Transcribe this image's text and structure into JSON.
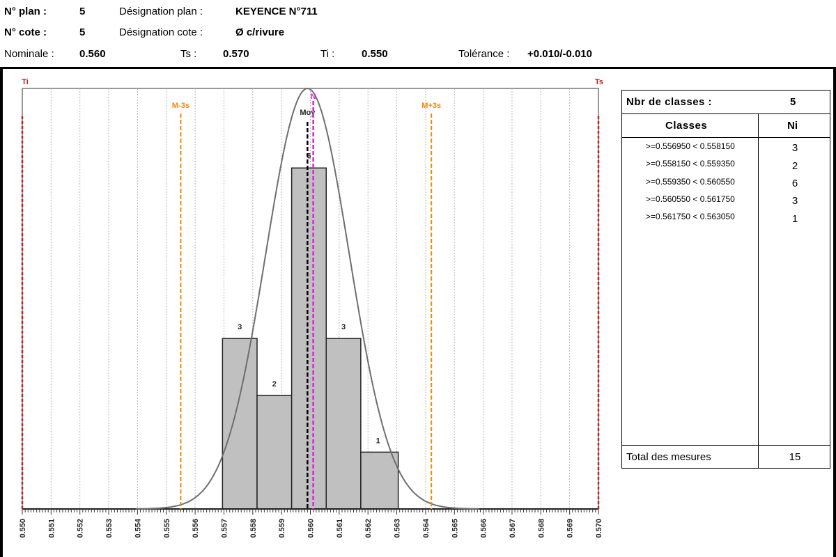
{
  "header": {
    "plan_no_label": "N° plan :",
    "plan_no_value": "5",
    "plan_designation_label": "Désignation plan :",
    "plan_designation_value": "KEYENCE N°711",
    "cote_no_label": "N° cote :",
    "cote_no_value": "5",
    "cote_designation_label": "Désignation cote :",
    "cote_designation_value": "Ø c/rivure",
    "nominale_label": "Nominale :",
    "nominale_value": "0.560",
    "ts_label": "Ts :",
    "ts_value": "0.570",
    "ti_label": "Ti :",
    "ti_value": "0.550",
    "tolerance_label": "Tolérance :",
    "tolerance_value": "+0.010/-0.010"
  },
  "table": {
    "nbr_classes_label": "Nbr de classes :",
    "nbr_classes_value": "5",
    "col_classes": "Classes",
    "col_ni": "Ni",
    "rows": [
      {
        "range": ">=0.556950 < 0.558150",
        "ni": "3"
      },
      {
        "range": ">=0.558150 < 0.559350",
        "ni": "2"
      },
      {
        "range": ">=0.559350 < 0.560550",
        "ni": "6"
      },
      {
        "range": ">=0.560550 < 0.561750",
        "ni": "3"
      },
      {
        "range": ">=0.561750 < 0.563050",
        "ni": "1"
      }
    ],
    "total_label": "Total des mesures",
    "total_value": "15"
  },
  "colors": {
    "limit": "#cc1f1f",
    "sigma": "#f08a00",
    "nominal": "#e01ee0",
    "mean": "#000000",
    "bar_fill": "#c0c0c0",
    "curve": "#6e6e6e"
  },
  "chart_data": {
    "type": "bar",
    "subtype": "histogram",
    "x_min": 0.55,
    "x_max": 0.57,
    "x_ticks": [
      "0.550",
      "0.551",
      "0.552",
      "0.553",
      "0.554",
      "0.555",
      "0.556",
      "0.557",
      "0.558",
      "0.559",
      "0.560",
      "0.561",
      "0.562",
      "0.563",
      "0.564",
      "0.565",
      "0.566",
      "0.567",
      "0.568",
      "0.569",
      "0.570"
    ],
    "bins": [
      {
        "from": 0.55695,
        "to": 0.55815,
        "count": 3
      },
      {
        "from": 0.55815,
        "to": 0.55935,
        "count": 2
      },
      {
        "from": 0.55935,
        "to": 0.56055,
        "count": 6
      },
      {
        "from": 0.56055,
        "to": 0.56175,
        "count": 3
      },
      {
        "from": 0.56175,
        "to": 0.56305,
        "count": 1
      }
    ],
    "bar_labels": [
      "3",
      "2",
      "6",
      "3",
      "1"
    ],
    "lines": [
      {
        "label": "Ti",
        "x": 0.55,
        "kind": "limit"
      },
      {
        "label": "Ts",
        "x": 0.57,
        "kind": "limit"
      },
      {
        "label": "M-3s",
        "x": 0.5555,
        "kind": "sigma"
      },
      {
        "label": "M+3s",
        "x": 0.5642,
        "kind": "sigma"
      },
      {
        "label": "Moy",
        "x": 0.5599,
        "kind": "mean"
      },
      {
        "label": "N",
        "x": 0.5601,
        "kind": "nominal"
      }
    ],
    "curve": {
      "mean": 0.5599,
      "sigma": 0.00145,
      "peak_count": 7.4
    },
    "y_max": 7.4,
    "grid": true
  }
}
